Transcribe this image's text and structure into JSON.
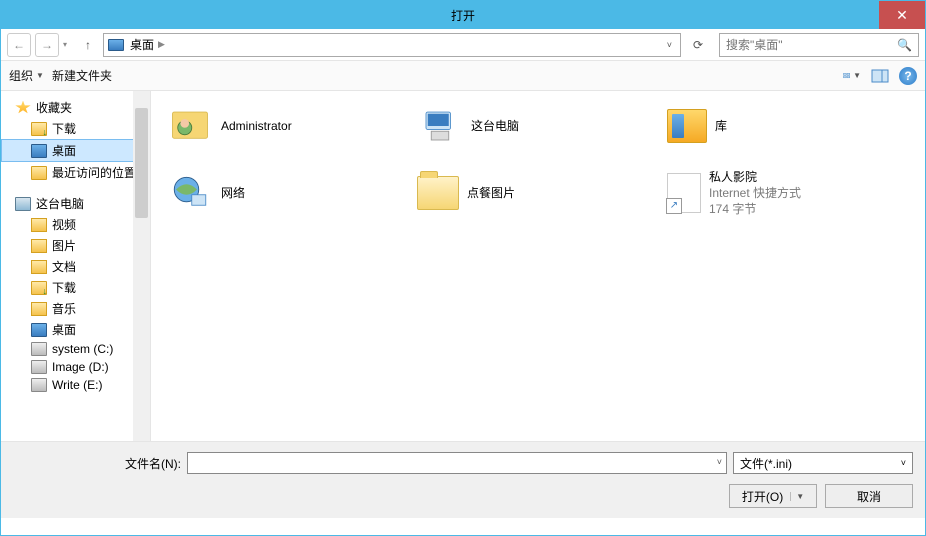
{
  "window": {
    "title": "打开"
  },
  "nav": {
    "location": "桌面",
    "search_placeholder": "搜索\"桌面\""
  },
  "toolbar": {
    "organize": "组织",
    "new_folder": "新建文件夹"
  },
  "sidebar": {
    "favorites": "收藏夹",
    "downloads": "下载",
    "desktop": "桌面",
    "recent": "最近访问的位置",
    "this_pc": "这台电脑",
    "videos": "视频",
    "pictures": "图片",
    "documents": "文档",
    "downloads2": "下载",
    "music": "音乐",
    "desktop2": "桌面",
    "drive_c": "system (C:)",
    "drive_d": "Image (D:)",
    "drive_e": "Write (E:)"
  },
  "items": {
    "admin": "Administrator",
    "this_pc": "这台电脑",
    "libraries": "库",
    "network": "网络",
    "folder1": "点餐图片",
    "shortcut_name": "私人影院",
    "shortcut_type": "Internet 快捷方式",
    "shortcut_size": "174 字节"
  },
  "bottom": {
    "filename_label": "文件名(N):",
    "filter": "文件(*.ini)",
    "open": "打开(O)",
    "cancel": "取消"
  }
}
